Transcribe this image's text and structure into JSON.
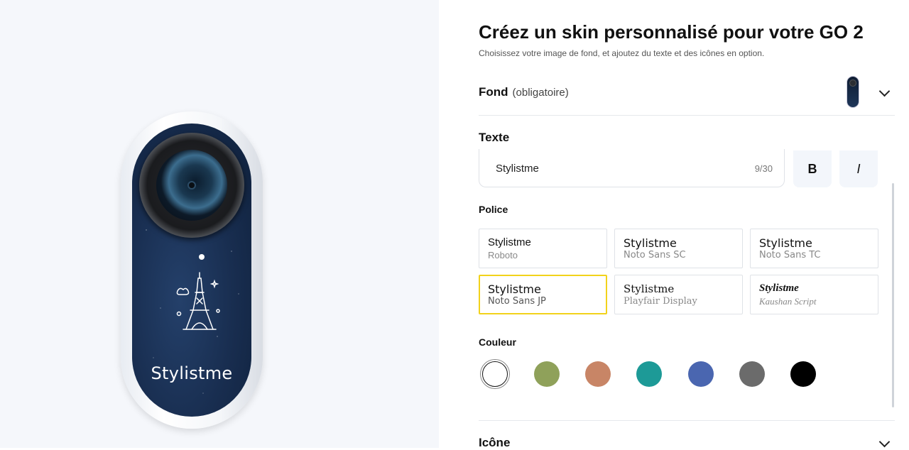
{
  "preview": {
    "camera_text": "Stylistme",
    "background_name": "starry-night-eiffel"
  },
  "header": {
    "title": "Créez un skin personnalisé pour votre GO 2",
    "subtitle": "Choisissez votre image de fond, et ajoutez du texte et des icônes en option."
  },
  "fond": {
    "label": "Fond",
    "optional_note": "(obligatoire)"
  },
  "texte": {
    "label": "Texte",
    "input_value": "Stylistme",
    "char_count": "9/30",
    "bold_label": "B",
    "italic_label": "I"
  },
  "police": {
    "label": "Police",
    "fonts": [
      {
        "sample": "Stylistme",
        "name": "Roboto"
      },
      {
        "sample": "Stylistme",
        "name": "Noto Sans SC"
      },
      {
        "sample": "Stylistme",
        "name": "Noto Sans TC"
      },
      {
        "sample": "Stylistme",
        "name": "Noto Sans JP"
      },
      {
        "sample": "Stylistme",
        "name": "Playfair Display"
      },
      {
        "sample": "Stylistme",
        "name": "Kaushan Script"
      }
    ],
    "selected": "Noto Sans JP"
  },
  "couleur": {
    "label": "Couleur",
    "swatches": [
      "#ffffff",
      "#8fa15a",
      "#c88566",
      "#1d9a97",
      "#4a66b0",
      "#6b6b6b",
      "#000000"
    ],
    "selected": "#ffffff"
  },
  "icone": {
    "label": "Icône"
  },
  "colors": {
    "accent_selected": "#f2d21b",
    "camera_body": "#182d4f"
  }
}
